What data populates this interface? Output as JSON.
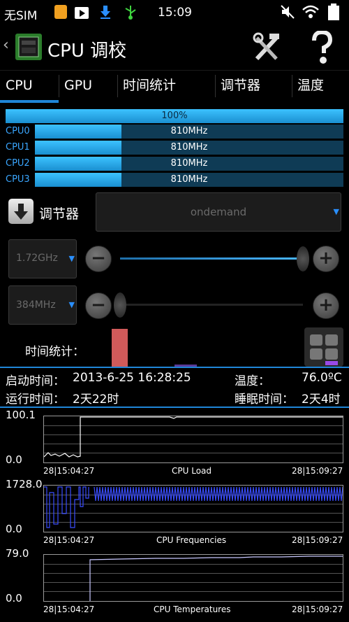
{
  "status_bar": {
    "carrier": "无SIM",
    "time": "15:09"
  },
  "app_bar": {
    "title": "CPU 调校"
  },
  "tabs": [
    {
      "label": "CPU",
      "active": true
    },
    {
      "label": "GPU",
      "active": false
    },
    {
      "label": "时间统计",
      "active": false
    },
    {
      "label": "调节器",
      "active": false
    },
    {
      "label": "温度",
      "active": false
    }
  ],
  "total_usage": {
    "label": "100%",
    "value": 1.0
  },
  "cpus": [
    {
      "label": "CPU0",
      "freq": "810MHz",
      "load": 0.28
    },
    {
      "label": "CPU1",
      "freq": "810MHz",
      "load": 0.28
    },
    {
      "label": "CPU2",
      "freq": "810MHz",
      "load": 0.28
    },
    {
      "label": "CPU3",
      "freq": "810MHz",
      "load": 0.28
    }
  ],
  "governor": {
    "label": "调节器",
    "value": "ondemand"
  },
  "max_freq": {
    "value": "1.72GHz",
    "level": 1.0
  },
  "min_freq": {
    "value": "384MHz",
    "level": 0.0
  },
  "time_stats": {
    "label": "时间统计："
  },
  "info": {
    "boot_label": "启动时间：",
    "boot_value": "2013-6-25 16:28:25",
    "run_label": "运行时间：",
    "run_value": "2天22时",
    "temp_label": "温度：",
    "temp_value": "76.0ºC",
    "sleep_label": "睡眠时间：",
    "sleep_value": "2天4时"
  },
  "graphs": [
    {
      "ymax": "100.1",
      "ymin": "0.0",
      "title": "CPU Load",
      "start": "28|15:04:27",
      "end": "28|15:09:27",
      "color": "#ffffff"
    },
    {
      "ymax": "1728.0",
      "ymin": "0.0",
      "title": "CPU Frequencies",
      "start": "28|15:04:27",
      "end": "28|15:09:27",
      "color": "#3a4dff"
    },
    {
      "ymax": "79.0",
      "ymin": "0.0",
      "title": "CPU Temperatures",
      "start": "28|15:04:27",
      "end": "28|15:09:27",
      "color": "#c8c8ff"
    }
  ]
}
